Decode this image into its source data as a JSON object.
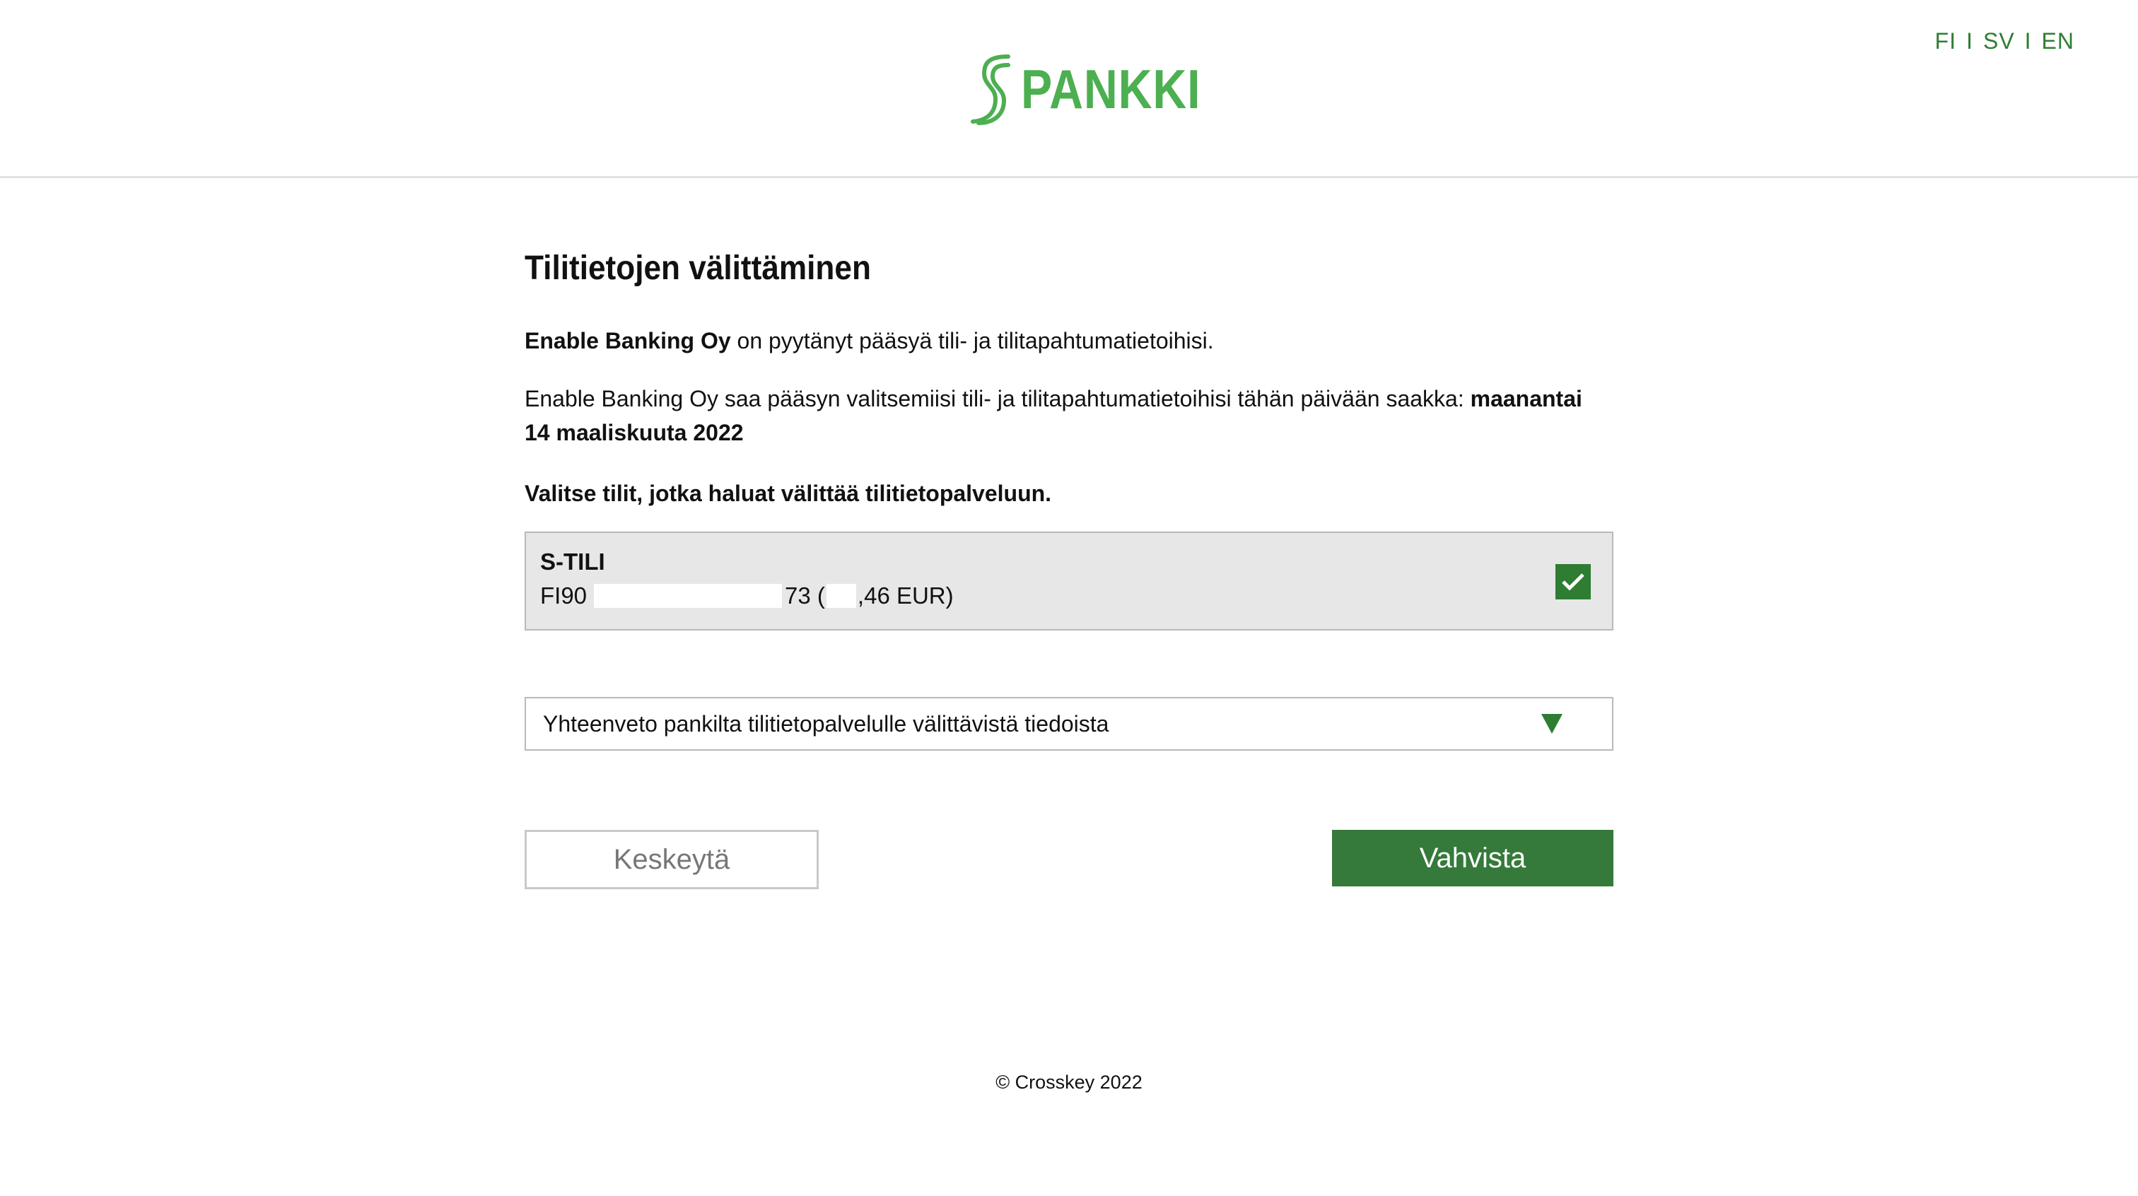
{
  "header": {
    "logo_text": "PANKKI",
    "brand_color": "#4caf50",
    "languages": [
      "FI",
      "SV",
      "EN"
    ],
    "lang_separator": "I"
  },
  "main": {
    "title": "Tilitietojen välittäminen",
    "request_company": "Enable Banking Oy",
    "request_text": " on pyytänyt pääsyä tili- ja tilitapahtumatietoihisi.",
    "access_text": "Enable Banking Oy saa pääsyn valitsemiisi tili- ja tilitapahtumatietoihisi tähän päivään saakka: ",
    "access_date": "maanantai 14 maaliskuuta 2022",
    "choose_label": "Valitse tilit, jotka haluat välittää tilitietopalveluun.",
    "account": {
      "name": "S-TILI",
      "iban_prefix": "FI90",
      "iban_suffix": "73 (",
      "balance_suffix": ",46 EUR)",
      "checked": true,
      "check_icon": "checkmark-icon"
    },
    "summary_label": "Yhteenveto pankilta tilitietopalvelulle välittävistä tiedoista",
    "summary_icon": "triangle-down-icon",
    "cancel_label": "Keskeytä",
    "confirm_label": "Vahvista",
    "confirm_color": "#357a3a"
  },
  "footer": {
    "copyright": "© Crosskey 2022"
  }
}
